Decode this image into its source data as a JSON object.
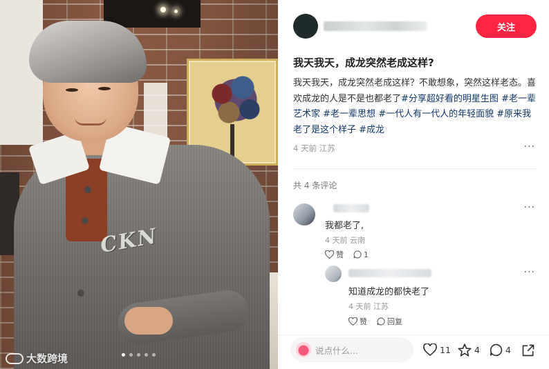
{
  "post": {
    "title": "我天我天，成龙突然老成这样?",
    "body_text": "我天我天，成龙突然老成这样？不敢想象，突然这样老态。喜欢成龙的人是不是也都老了",
    "tags": [
      "#分享超好看的明星生图",
      "#老一辈艺术家",
      "#老一辈思想",
      "#一代人有一代人的年轻面貌",
      "#原来我老了是这个样子",
      "#成龙"
    ],
    "meta": "4 天前 江苏"
  },
  "author": {
    "follow_label": "关注"
  },
  "comments": {
    "count_label": "共 4 条评论",
    "items": [
      {
        "text": "我都老了,",
        "meta": "4 天前 云南",
        "like_label": "赞",
        "reply_count": "1"
      },
      {
        "text": "知道成龙的都快老了",
        "meta": "4 天前 江苏",
        "like_label": "赞",
        "reply_label": "回复"
      }
    ]
  },
  "bottom_bar": {
    "input_placeholder": "说点什么...",
    "likes": "11",
    "collects": "4",
    "comments": "4"
  },
  "photo": {
    "shirt_logo": "CKN",
    "watermark": "大数跨境"
  },
  "colors": {
    "accent": "#ff2442",
    "tag": "#13386c"
  }
}
